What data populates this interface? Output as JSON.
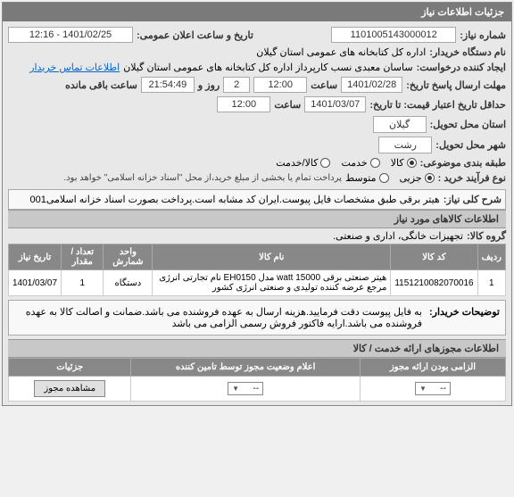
{
  "panel_title": "جزئیات اطلاعات نیاز",
  "fields": {
    "need_no_label": "شماره نیاز:",
    "need_no": "1101005143000012",
    "announce_label": "تاریخ و ساعت اعلان عمومی:",
    "announce_value": "1401/02/25 - 12:16",
    "buyer_name_label": "نام دستگاه خریدار:",
    "buyer_name": "اداره کل کتابخانه های عمومی استان گیلان",
    "requester_label": "ایجاد کننده درخواست:",
    "requester": "ساسان معبدی نسب کارپرداز اداره کل کتابخانه های عمومی استان گیلان",
    "contact_link": "اطلاعات تماس خریدار",
    "send_deadline_label": "مهلت ارسال پاسخ تاریخ:",
    "send_date": "1401/02/28",
    "time_label": "ساعت",
    "send_time": "12:00",
    "day_label": "روز و",
    "days_left": "2",
    "remain_time": "21:54:49",
    "remain_label": "ساعت باقی مانده",
    "valid_label": "حداقل تاریخ اعتبار قیمت: تا تاریخ:",
    "valid_date": "1401/03/07",
    "valid_time": "12:00",
    "province_label": "استان محل تحویل:",
    "province": "گیلان",
    "city_label": "شهر محل تحویل:",
    "city": "رشت",
    "category_label": "طبقه بندی موضوعی:",
    "cat_options": {
      "goods": "کالا",
      "service": "خدمت",
      "both": "کالا/خدمت"
    },
    "process_label": "نوع فرآیند خرید :",
    "proc_options": {
      "petty": "جزیی",
      "medium": "متوسط"
    },
    "process_note": "پرداخت تمام یا بخشی از مبلغ خرید،از محل \"اسناد خزانه اسلامی\" خواهد بود.",
    "summary_label": "شرح کلی نیاز:",
    "summary": "هیتر برقی طبق مشخصات فایل پیوست.ایران کد مشابه است.پرداخت بصورت اسناد خزانه اسلامی001"
  },
  "goods_section_title": "اطلاعات کالاهای مورد نیاز",
  "group_label": "گروه کالا:",
  "group_value": "تجهیزات خانگی، اداری و صنعتی.",
  "table": {
    "headers": [
      "ردیف",
      "کد کالا",
      "نام کالا",
      "واحد شمارش",
      "تعداد / مقدار",
      "تاریخ نیاز"
    ],
    "rows": [
      {
        "idx": "1",
        "code": "1151210082070016",
        "name": "هیتر صنعتی برقی 15000 watt مدل EH0150 نام تجارتی انرژی مرجع عرضه کننده تولیدی و صنعتی انرژی کشور",
        "unit": "دستگاه",
        "qty": "1",
        "date": "1401/03/07"
      }
    ]
  },
  "buyer_note_label": "توضیحات خریدار:",
  "buyer_note": "به فایل پیوست دقت فرمایید.هزینه ارسال به عهده فروشنده می باشد.ضمانت و اصالت کالا به عهده فروشنده می باشد.ارایه فاکتور فروش رسمی الزامی می باشد",
  "permit_section_title": "اطلاعات مجوزهای ارائه خدمت / کالا",
  "status_headers": [
    "الزامی بودن ارائه مجوز",
    "اعلام وضعیت مجوز توسط تامین کننده",
    "جزئیات"
  ],
  "status_select": "--",
  "status_select2": "--",
  "view_permit_btn": "مشاهده مجوز"
}
